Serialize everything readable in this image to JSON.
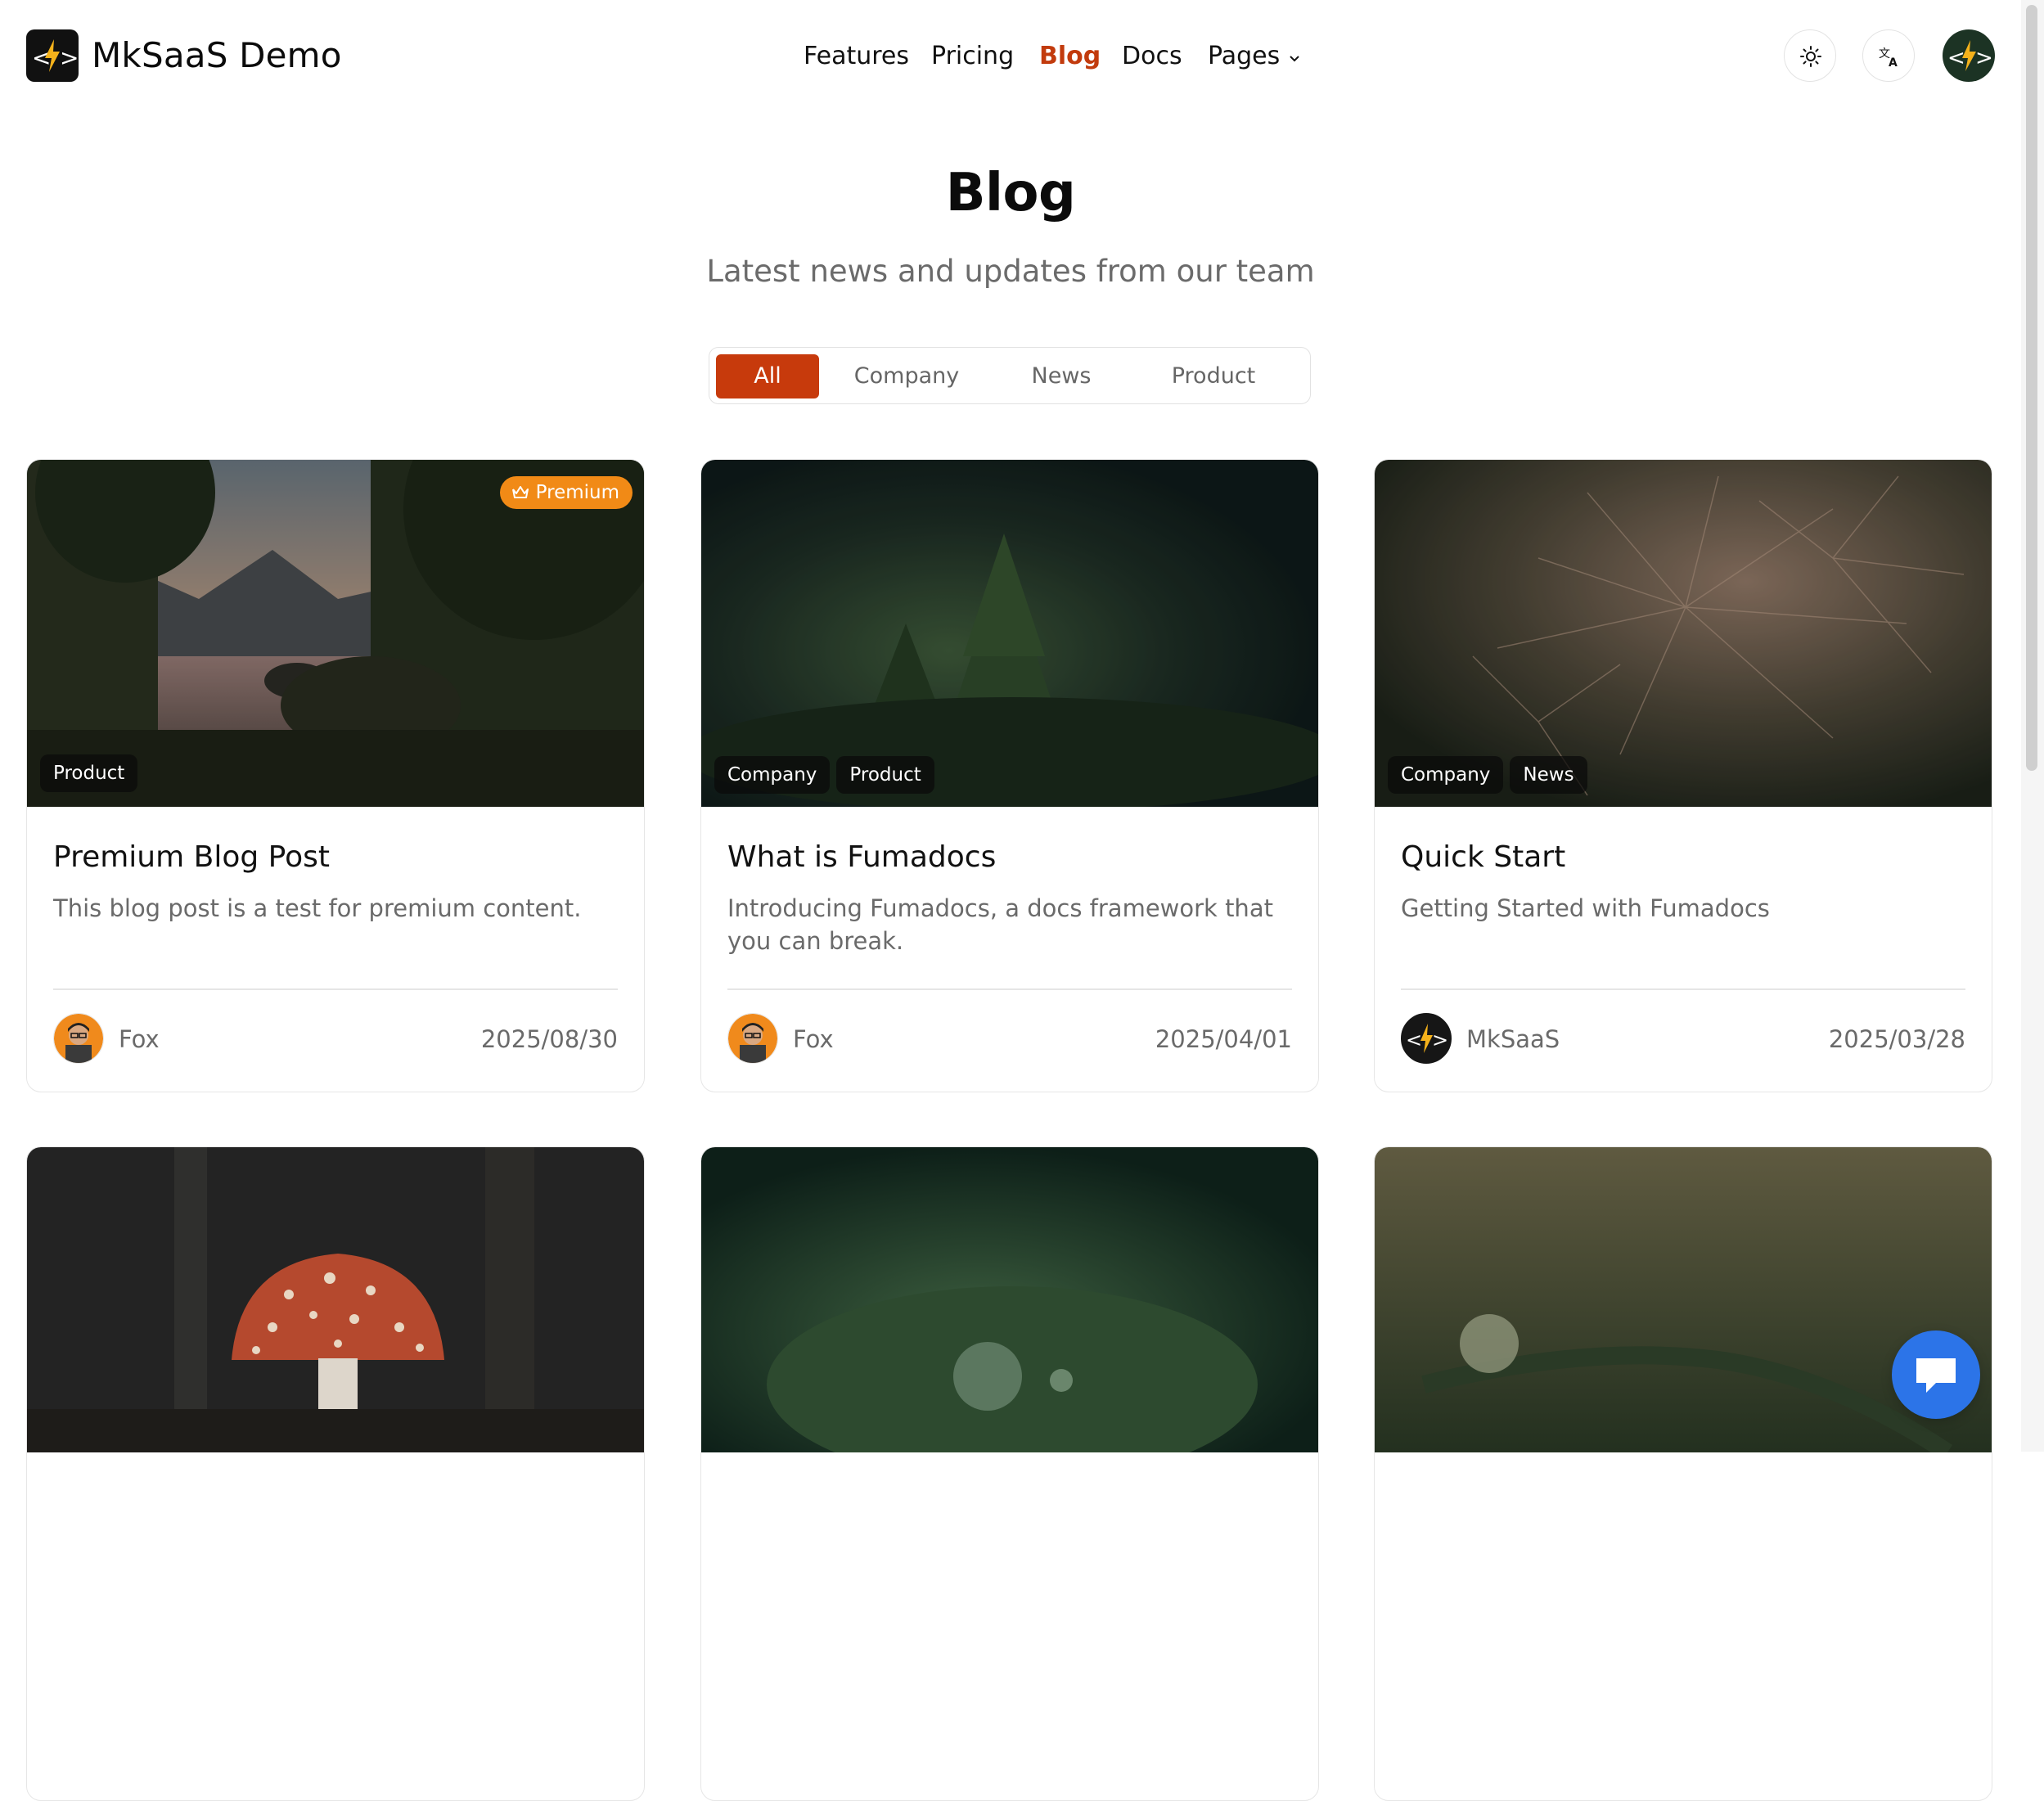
{
  "header": {
    "brand": "MkSaaS Demo",
    "nav": [
      "Features",
      "Pricing",
      "Blog",
      "Docs",
      "Pages"
    ],
    "active_nav": "Blog",
    "theme_icon": "sun-icon",
    "language_icon": "translate-icon",
    "avatar_icon": "mksaas-logo-icon"
  },
  "hero": {
    "title": "Blog",
    "subtitle": "Latest news and updates from our team"
  },
  "filters": {
    "tabs": [
      "All",
      "Company",
      "News",
      "Product"
    ],
    "active": "All"
  },
  "posts": [
    {
      "title": "Premium Blog Post",
      "description": "This blog post is a test for premium content.",
      "badge": "Premium",
      "tags": [
        "Product"
      ],
      "author": "Fox",
      "date": "2025/08/30"
    },
    {
      "title": "What is Fumadocs",
      "description": "Introducing Fumadocs, a docs framework that you can break.",
      "tags": [
        "Company",
        "Product"
      ],
      "author": "Fox",
      "date": "2025/04/01"
    },
    {
      "title": "Quick Start",
      "description": "Getting Started with Fumadocs",
      "tags": [
        "Company",
        "News"
      ],
      "author": "MkSaaS",
      "date": "2025/03/28"
    },
    {},
    {},
    {}
  ],
  "colors": {
    "accent": "#c73a0c",
    "premium": "#f18a16",
    "chat": "#2c74e8"
  },
  "chat_icon": "chat-bubble-icon"
}
